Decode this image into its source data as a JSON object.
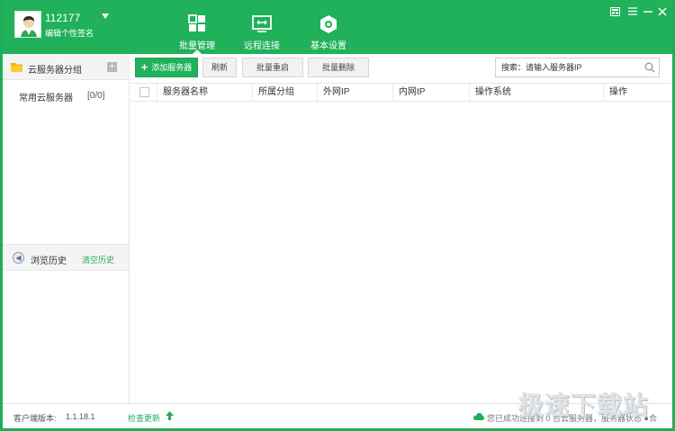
{
  "user": {
    "name": "112177",
    "signature": "编辑个性签名"
  },
  "nav": {
    "tabs": [
      {
        "label": "批量管理",
        "icon": "grid-icon",
        "active": true
      },
      {
        "label": "远程连接",
        "icon": "remote-screen-icon",
        "active": false
      },
      {
        "label": "基本设置",
        "icon": "settings-hex-icon",
        "active": false
      }
    ]
  },
  "window_controls": [
    "skin-icon",
    "menu-icon",
    "minimize-icon",
    "close-icon"
  ],
  "sidebar": {
    "title": "云服务器分组",
    "groups": [
      {
        "name": "常用云服务器",
        "count": "[0/0]"
      }
    ],
    "history_label": "浏览历史",
    "clear_history": "清空历史"
  },
  "toolbar": {
    "add_label": "添加服务器",
    "refresh_label": "刷新",
    "batch_restart_label": "批量重启",
    "batch_delete_label": "批量删除",
    "search_placeholder": "搜索：请输入服务器IP"
  },
  "table": {
    "columns": [
      "服务器名称",
      "所属分组",
      "外网IP",
      "内网IP",
      "操作系统",
      "操作"
    ],
    "rows": []
  },
  "status": {
    "version_label": "客户端版本:",
    "version_value": "1.1.18.1",
    "check_update": "检查更新",
    "connection_text": "您已成功连接到 0 台云服务器，服务器状态 ●合"
  },
  "watermark": "极速下载站",
  "colors": {
    "brand_green": "#20b15a",
    "text": "#333333"
  }
}
